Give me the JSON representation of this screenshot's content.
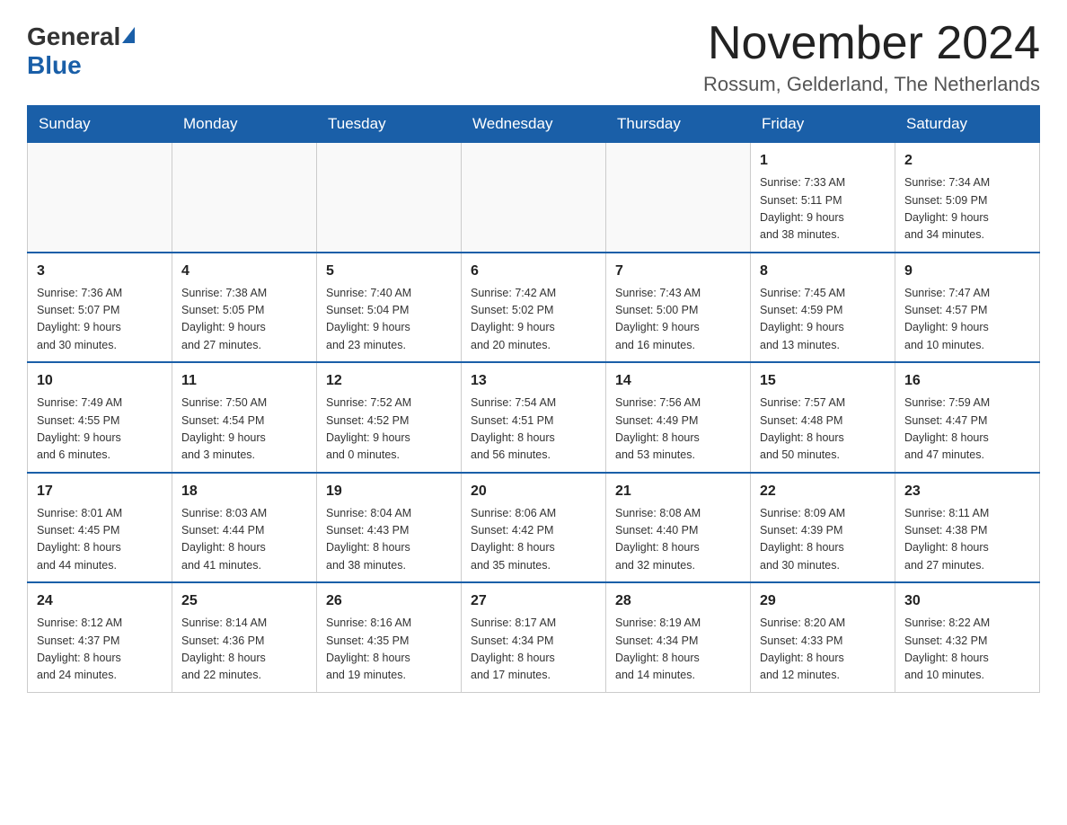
{
  "logo": {
    "general": "General",
    "blue": "Blue"
  },
  "title": "November 2024",
  "location": "Rossum, Gelderland, The Netherlands",
  "weekdays": [
    "Sunday",
    "Monday",
    "Tuesday",
    "Wednesday",
    "Thursday",
    "Friday",
    "Saturday"
  ],
  "weeks": [
    [
      {
        "day": "",
        "info": ""
      },
      {
        "day": "",
        "info": ""
      },
      {
        "day": "",
        "info": ""
      },
      {
        "day": "",
        "info": ""
      },
      {
        "day": "",
        "info": ""
      },
      {
        "day": "1",
        "info": "Sunrise: 7:33 AM\nSunset: 5:11 PM\nDaylight: 9 hours\nand 38 minutes."
      },
      {
        "day": "2",
        "info": "Sunrise: 7:34 AM\nSunset: 5:09 PM\nDaylight: 9 hours\nand 34 minutes."
      }
    ],
    [
      {
        "day": "3",
        "info": "Sunrise: 7:36 AM\nSunset: 5:07 PM\nDaylight: 9 hours\nand 30 minutes."
      },
      {
        "day": "4",
        "info": "Sunrise: 7:38 AM\nSunset: 5:05 PM\nDaylight: 9 hours\nand 27 minutes."
      },
      {
        "day": "5",
        "info": "Sunrise: 7:40 AM\nSunset: 5:04 PM\nDaylight: 9 hours\nand 23 minutes."
      },
      {
        "day": "6",
        "info": "Sunrise: 7:42 AM\nSunset: 5:02 PM\nDaylight: 9 hours\nand 20 minutes."
      },
      {
        "day": "7",
        "info": "Sunrise: 7:43 AM\nSunset: 5:00 PM\nDaylight: 9 hours\nand 16 minutes."
      },
      {
        "day": "8",
        "info": "Sunrise: 7:45 AM\nSunset: 4:59 PM\nDaylight: 9 hours\nand 13 minutes."
      },
      {
        "day": "9",
        "info": "Sunrise: 7:47 AM\nSunset: 4:57 PM\nDaylight: 9 hours\nand 10 minutes."
      }
    ],
    [
      {
        "day": "10",
        "info": "Sunrise: 7:49 AM\nSunset: 4:55 PM\nDaylight: 9 hours\nand 6 minutes."
      },
      {
        "day": "11",
        "info": "Sunrise: 7:50 AM\nSunset: 4:54 PM\nDaylight: 9 hours\nand 3 minutes."
      },
      {
        "day": "12",
        "info": "Sunrise: 7:52 AM\nSunset: 4:52 PM\nDaylight: 9 hours\nand 0 minutes."
      },
      {
        "day": "13",
        "info": "Sunrise: 7:54 AM\nSunset: 4:51 PM\nDaylight: 8 hours\nand 56 minutes."
      },
      {
        "day": "14",
        "info": "Sunrise: 7:56 AM\nSunset: 4:49 PM\nDaylight: 8 hours\nand 53 minutes."
      },
      {
        "day": "15",
        "info": "Sunrise: 7:57 AM\nSunset: 4:48 PM\nDaylight: 8 hours\nand 50 minutes."
      },
      {
        "day": "16",
        "info": "Sunrise: 7:59 AM\nSunset: 4:47 PM\nDaylight: 8 hours\nand 47 minutes."
      }
    ],
    [
      {
        "day": "17",
        "info": "Sunrise: 8:01 AM\nSunset: 4:45 PM\nDaylight: 8 hours\nand 44 minutes."
      },
      {
        "day": "18",
        "info": "Sunrise: 8:03 AM\nSunset: 4:44 PM\nDaylight: 8 hours\nand 41 minutes."
      },
      {
        "day": "19",
        "info": "Sunrise: 8:04 AM\nSunset: 4:43 PM\nDaylight: 8 hours\nand 38 minutes."
      },
      {
        "day": "20",
        "info": "Sunrise: 8:06 AM\nSunset: 4:42 PM\nDaylight: 8 hours\nand 35 minutes."
      },
      {
        "day": "21",
        "info": "Sunrise: 8:08 AM\nSunset: 4:40 PM\nDaylight: 8 hours\nand 32 minutes."
      },
      {
        "day": "22",
        "info": "Sunrise: 8:09 AM\nSunset: 4:39 PM\nDaylight: 8 hours\nand 30 minutes."
      },
      {
        "day": "23",
        "info": "Sunrise: 8:11 AM\nSunset: 4:38 PM\nDaylight: 8 hours\nand 27 minutes."
      }
    ],
    [
      {
        "day": "24",
        "info": "Sunrise: 8:12 AM\nSunset: 4:37 PM\nDaylight: 8 hours\nand 24 minutes."
      },
      {
        "day": "25",
        "info": "Sunrise: 8:14 AM\nSunset: 4:36 PM\nDaylight: 8 hours\nand 22 minutes."
      },
      {
        "day": "26",
        "info": "Sunrise: 8:16 AM\nSunset: 4:35 PM\nDaylight: 8 hours\nand 19 minutes."
      },
      {
        "day": "27",
        "info": "Sunrise: 8:17 AM\nSunset: 4:34 PM\nDaylight: 8 hours\nand 17 minutes."
      },
      {
        "day": "28",
        "info": "Sunrise: 8:19 AM\nSunset: 4:34 PM\nDaylight: 8 hours\nand 14 minutes."
      },
      {
        "day": "29",
        "info": "Sunrise: 8:20 AM\nSunset: 4:33 PM\nDaylight: 8 hours\nand 12 minutes."
      },
      {
        "day": "30",
        "info": "Sunrise: 8:22 AM\nSunset: 4:32 PM\nDaylight: 8 hours\nand 10 minutes."
      }
    ]
  ]
}
